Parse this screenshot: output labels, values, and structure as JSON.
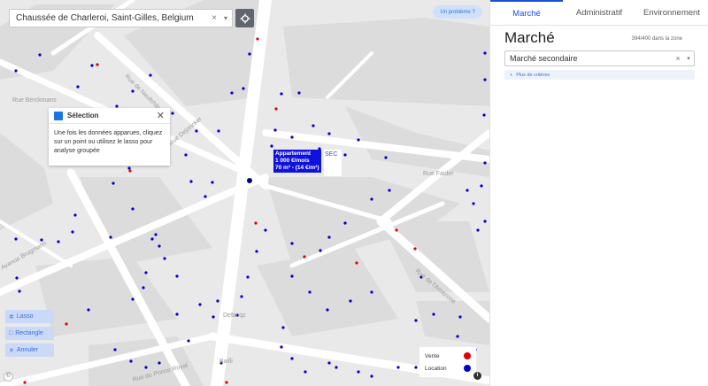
{
  "map": {
    "search": {
      "value": "Chaussée de Charleroi, Saint-Gilles, Belgium",
      "clear": "×",
      "chevron": "▾"
    },
    "locate_icon": "crosshair-icon",
    "problem_button": "Un problème ?",
    "street_labels": [
      "Rue de Neufchâtel",
      "Rue Berckmans",
      "Rue Dejoncker",
      "Avenue Brugmann",
      "Rue de l'Amazone",
      "Defacqz",
      "Bailli",
      "Rue Faider",
      "Rue du Prince Royal"
    ],
    "selection": {
      "title": "Sélection",
      "close": "✕",
      "text": "Une fois les données apparues, cliquez sur un point ou utilisez le lasso pour analyse groupée"
    },
    "tooltip": {
      "line1": "Appartement",
      "line2": "1 000 €/mois",
      "line3": "70 m² - (14 €/m²)"
    },
    "sec_label": "SEC",
    "tools": [
      {
        "icon": "lasso-icon",
        "glyph": "✲",
        "label": "Lasso"
      },
      {
        "icon": "rectangle-icon",
        "glyph": "□",
        "label": "Rectangle"
      },
      {
        "icon": "undo-icon",
        "glyph": "✕",
        "label": "Annuler"
      }
    ],
    "legend": [
      {
        "label": "Vente",
        "color": "#e00000"
      },
      {
        "label": "Location",
        "color": "#0000cc"
      }
    ],
    "info": "i",
    "attribution": "©"
  },
  "panel": {
    "tabs": [
      {
        "label": "Marché",
        "active": true
      },
      {
        "label": "Administratif",
        "active": false
      },
      {
        "label": "Environnement",
        "active": false
      }
    ],
    "title": "Marché",
    "count": "394/400 dans la zone",
    "select": {
      "value": "Marché secondaire",
      "clear": "×",
      "chevron": "▾"
    },
    "more": {
      "icon": "plus-icon",
      "glyph": "+",
      "label": "Plus de critères"
    }
  },
  "colors": {
    "accent": "#1a4fd6",
    "sale": "#e00000",
    "rent": "#0000cc"
  }
}
